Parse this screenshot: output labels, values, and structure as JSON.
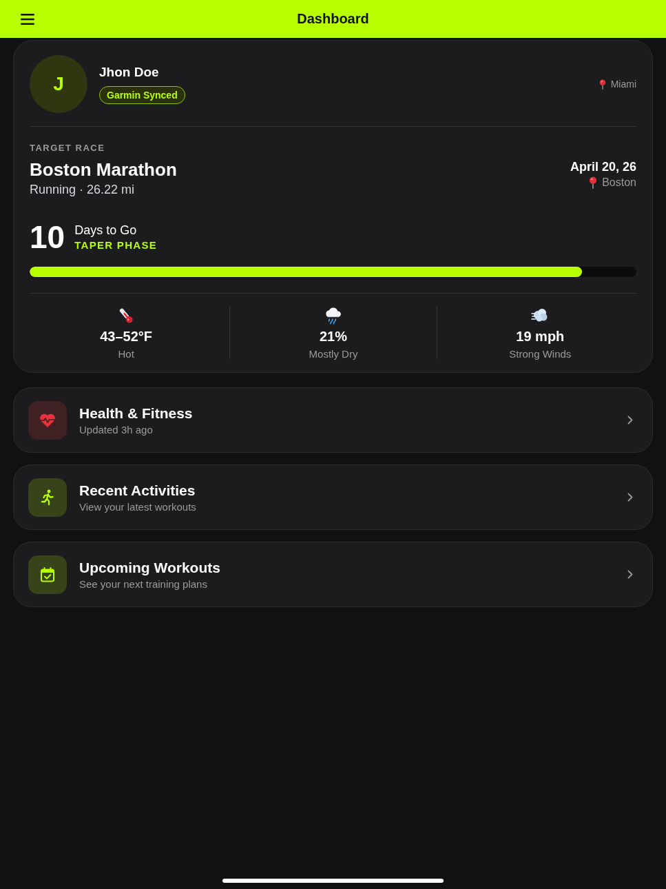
{
  "header": {
    "title": "Dashboard"
  },
  "profile": {
    "initial": "J",
    "name": "Jhon Doe",
    "badge": "Garmin Synced",
    "location": "Miami"
  },
  "target_race": {
    "label": "TARGET RACE",
    "name": "Boston Marathon",
    "details": "Running · 26.22 mi",
    "date": "April 20, 26",
    "location": "Boston",
    "countdown": "10",
    "countdown_label": "Days to Go",
    "phase": "TAPER PHASE",
    "progress": {
      "level": 0.91
    }
  },
  "weather": [
    {
      "kind": "temperature",
      "value": "43–52°F",
      "label": "Hot"
    },
    {
      "kind": "rain",
      "value": "21%",
      "label": "Mostly Dry"
    },
    {
      "kind": "wind",
      "value": "19 mph",
      "label": "Strong Winds"
    }
  ],
  "nav_cards": [
    {
      "kind": "heart",
      "color": "#e8323c",
      "title": "Health & Fitness",
      "subtitle": "Updated 3h ago"
    },
    {
      "kind": "runner",
      "color": "#b8ff00",
      "title": "Recent Activities",
      "subtitle": "View your latest workouts"
    },
    {
      "kind": "calendar",
      "color": "#b8ff00",
      "title": "Upcoming Workouts",
      "subtitle": "See your next training plans"
    }
  ]
}
